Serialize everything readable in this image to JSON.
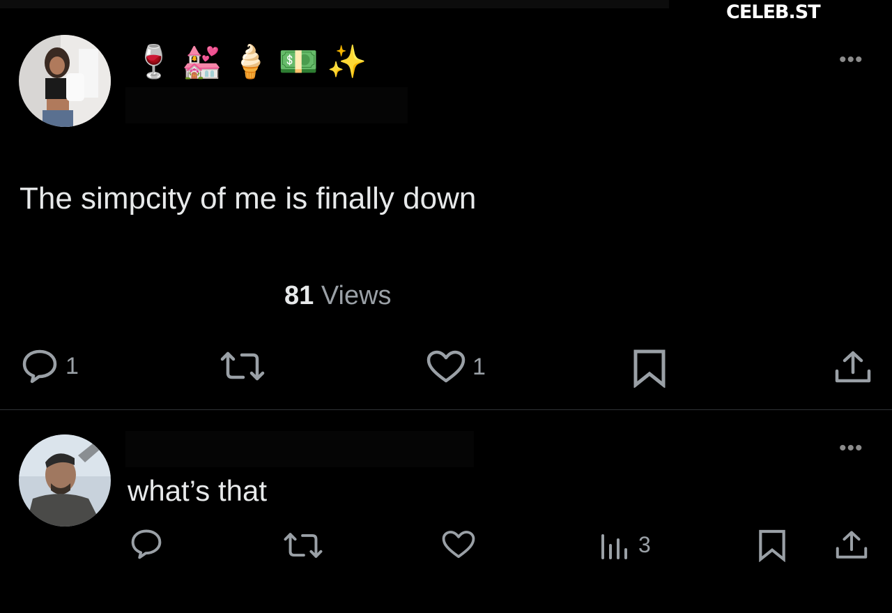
{
  "watermark": "CELEB.ST",
  "tweet": {
    "emojis": [
      "🍷",
      "💒",
      "🍦",
      "💵",
      "✨"
    ],
    "text": "The simpcity of me is finally down",
    "views_count": "81",
    "views_label": "Views",
    "reply_count": "1",
    "like_count": "1",
    "more_icon": "more-dots-icon"
  },
  "reply": {
    "text": "what’s that",
    "views_count": "3"
  },
  "colors": {
    "background": "#000000",
    "text": "#e7e9ea",
    "muted": "#8b8b8b",
    "divider": "#2f3336"
  }
}
